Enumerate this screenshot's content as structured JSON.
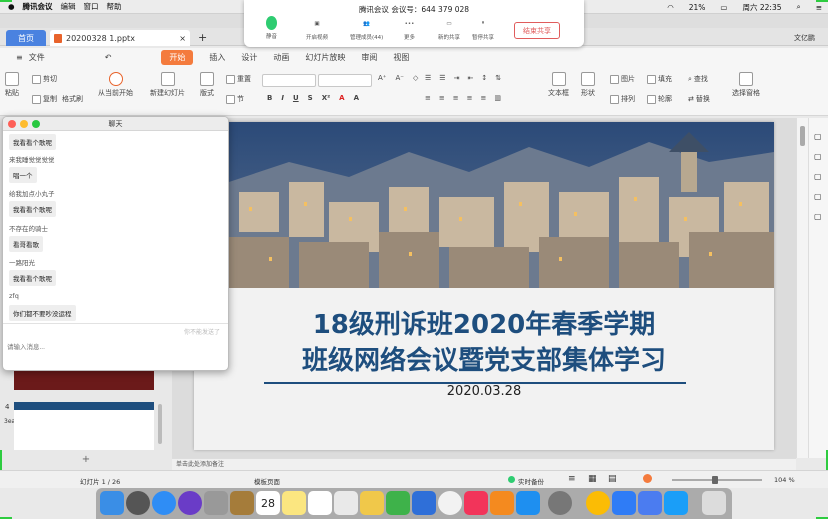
{
  "menubar": {
    "app": "腾讯会议",
    "items": [
      "编辑",
      "窗口",
      "帮助"
    ],
    "battery": "21%",
    "clock": "周六 22:35"
  },
  "tabs": {
    "home": "首页",
    "doc": "20200328 1.pptx",
    "new": "+",
    "user": "文亿鹏"
  },
  "ribbon_tabs": {
    "file": "文件",
    "items": [
      "开始",
      "插入",
      "设计",
      "动画",
      "幻灯片放映",
      "审阅",
      "视图"
    ]
  },
  "ribbon": {
    "paste": "粘贴",
    "cut": "剪切",
    "copy": "复制",
    "format_painter": "格式刷",
    "play": "从当前开始",
    "new_slide": "新建幻灯片",
    "layout": "版式",
    "section": "节",
    "reset": "重置",
    "textbox": "文本框",
    "shape": "形状",
    "arrange": "排列",
    "image": "图片",
    "fill": "填充",
    "outline": "轮廓",
    "find": "查找",
    "replace": "替换",
    "select_pane": "选择窗格"
  },
  "meeting": {
    "title": "腾讯会议 会议号：644 379 028",
    "tools": [
      "静音",
      "开启视频",
      "管理成员(44)",
      "更多",
      "新的共享",
      "暂停共享"
    ],
    "end": "结束共享"
  },
  "chat": {
    "title": "聊天",
    "messages": [
      {
        "sender": "",
        "text": "我看看个歌呢"
      },
      {
        "sender": "来我睡觉觉觉觉",
        "text": "唱一个"
      },
      {
        "sender": "给我加点小丸子",
        "text": "我看看个歌呢"
      },
      {
        "sender": "不存在的骑士",
        "text": "看哥看歌"
      },
      {
        "sender": "一路阳光",
        "text": "我看看个歌呢"
      },
      {
        "sender": "zfq",
        "text": "你们都不要吵没运程"
      }
    ],
    "hint": "你不能发送了",
    "placeholder": "请输入消息..."
  },
  "slide": {
    "title1": "18级刑诉班2020年春季学期",
    "title2": "班级网络会议暨党支部集体学习",
    "date": "2020.03.28"
  },
  "thumbs": {
    "num4": "4",
    "num_line": "3ea"
  },
  "notes": "单击此处添加备注",
  "status": {
    "page": "幻灯片 1 / 26",
    "template": "模板页面",
    "backup": "实时备份",
    "zoom": "104 %"
  },
  "colors": {
    "accent": "#4a82e0",
    "orange": "#f47b3d",
    "title": "#1e4e7e"
  }
}
